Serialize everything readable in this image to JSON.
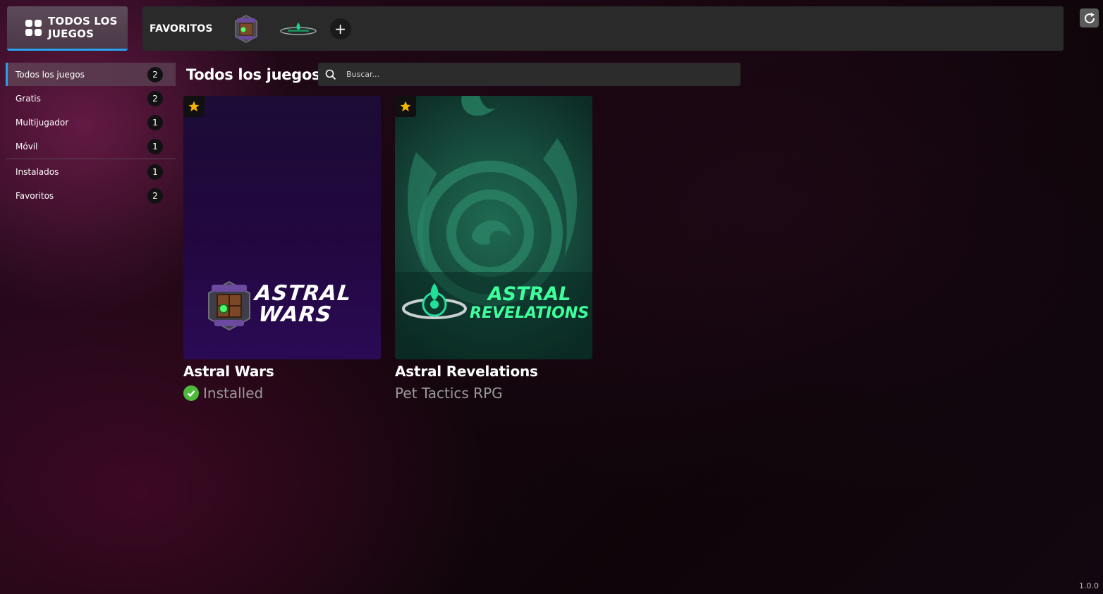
{
  "top_bar": {
    "home_label": "TODOS LOS JUEGOS",
    "favorites_label": "FAVORITOS",
    "favorite_icons": [
      "astral-wars-logo-icon",
      "astral-revelations-logo-icon"
    ],
    "add_label": "+",
    "accent": "#27a2ee"
  },
  "sidebar": {
    "items": [
      {
        "label": "Todos los juegos",
        "count": "2"
      },
      {
        "label": "Gratis",
        "count": "2"
      },
      {
        "label": "Multijugador",
        "count": "1"
      },
      {
        "label": "Móvil",
        "count": "1"
      },
      {
        "label": "Instalados",
        "count": "1"
      },
      {
        "label": "Favoritos",
        "count": "2"
      }
    ]
  },
  "main": {
    "title": "Todos los juegos",
    "search_placeholder": "Buscar...",
    "games": [
      {
        "name": "Astral Wars",
        "status": "Installed",
        "logo_line1": "ASTRAL",
        "logo_line2": "WARS",
        "favorite": true
      },
      {
        "name": "Astral Revelations",
        "status": "Pet Tactics RPG",
        "logo_line1": "ASTRAL",
        "logo_line2": "REVELATIONS",
        "favorite": true
      }
    ]
  },
  "footer": {
    "version": "1.0.0"
  },
  "colors": {
    "star": "#f5b400",
    "installed_check": "#4cba3c"
  }
}
